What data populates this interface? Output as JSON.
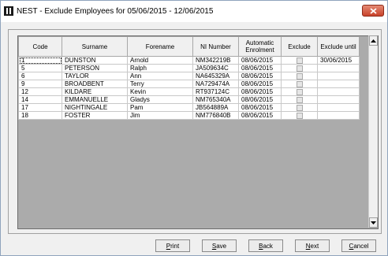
{
  "window": {
    "title": "NEST - Exclude Employees for 05/06/2015 - 12/06/2015"
  },
  "icons": {
    "app": "nest-app-icon",
    "close": "close-icon",
    "scroll_up": "arrow-up-icon",
    "scroll_down": "arrow-down-icon"
  },
  "colors": {
    "grid_background": "#ababab",
    "close_button": "#c9432b"
  },
  "table": {
    "columns": [
      "Code",
      "Surname",
      "Forename",
      "NI Number",
      "Automatic Enrolment",
      "Exclude",
      "Exclude until"
    ],
    "rows": [
      {
        "code": "1",
        "surname": "DUNSTON",
        "forename": "Arnold",
        "ni": "NM342219B",
        "enrolment": "08/06/2015",
        "exclude": false,
        "until": "30/06/2015"
      },
      {
        "code": "5",
        "surname": "PETERSON",
        "forename": "Ralph",
        "ni": "JA509634C",
        "enrolment": "08/06/2015",
        "exclude": false,
        "until": ""
      },
      {
        "code": "6",
        "surname": "TAYLOR",
        "forename": "Ann",
        "ni": "NA645329A",
        "enrolment": "08/06/2015",
        "exclude": false,
        "until": ""
      },
      {
        "code": "9",
        "surname": "BROADBENT",
        "forename": "Terry",
        "ni": "NA729474A",
        "enrolment": "08/06/2015",
        "exclude": false,
        "until": ""
      },
      {
        "code": "12",
        "surname": "KILDARE",
        "forename": "Kevin",
        "ni": "RT937124C",
        "enrolment": "08/06/2015",
        "exclude": false,
        "until": ""
      },
      {
        "code": "14",
        "surname": "EMMANUELLE",
        "forename": "Gladys",
        "ni": "NM765340A",
        "enrolment": "08/06/2015",
        "exclude": false,
        "until": ""
      },
      {
        "code": "17",
        "surname": "NIGHTINGALE",
        "forename": "Pam",
        "ni": "JB564889A",
        "enrolment": "08/06/2015",
        "exclude": false,
        "until": ""
      },
      {
        "code": "18",
        "surname": "FOSTER",
        "forename": "Jim",
        "ni": "NM776840B",
        "enrolment": "08/06/2015",
        "exclude": false,
        "until": ""
      }
    ]
  },
  "buttons": [
    {
      "name": "print-button",
      "label": "Print",
      "key": "P",
      "rest": "rint"
    },
    {
      "name": "save-button",
      "label": "Save",
      "key": "S",
      "rest": "ave"
    },
    {
      "name": "back-button",
      "label": "Back",
      "key": "B",
      "rest": "ack"
    },
    {
      "name": "next-button",
      "label": "Next",
      "key": "N",
      "rest": "ext"
    },
    {
      "name": "cancel-button",
      "label": "Cancel",
      "key": "C",
      "rest": "ancel"
    }
  ]
}
